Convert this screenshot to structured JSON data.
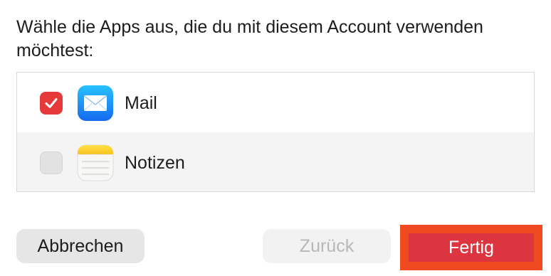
{
  "dialog": {
    "prompt": "Wähle die Apps aus, die du mit diesem Account verwenden möchtest:"
  },
  "apps": [
    {
      "label": "Mail",
      "checked": true,
      "icon": "mail-icon"
    },
    {
      "label": "Notizen",
      "checked": false,
      "icon": "notes-icon"
    }
  ],
  "buttons": {
    "cancel": "Abbrechen",
    "back": "Zurück",
    "done": "Fertig"
  },
  "colors": {
    "accent": "#e63a3a",
    "done_button": "#dc3540",
    "highlight_frame": "#f04a20"
  }
}
